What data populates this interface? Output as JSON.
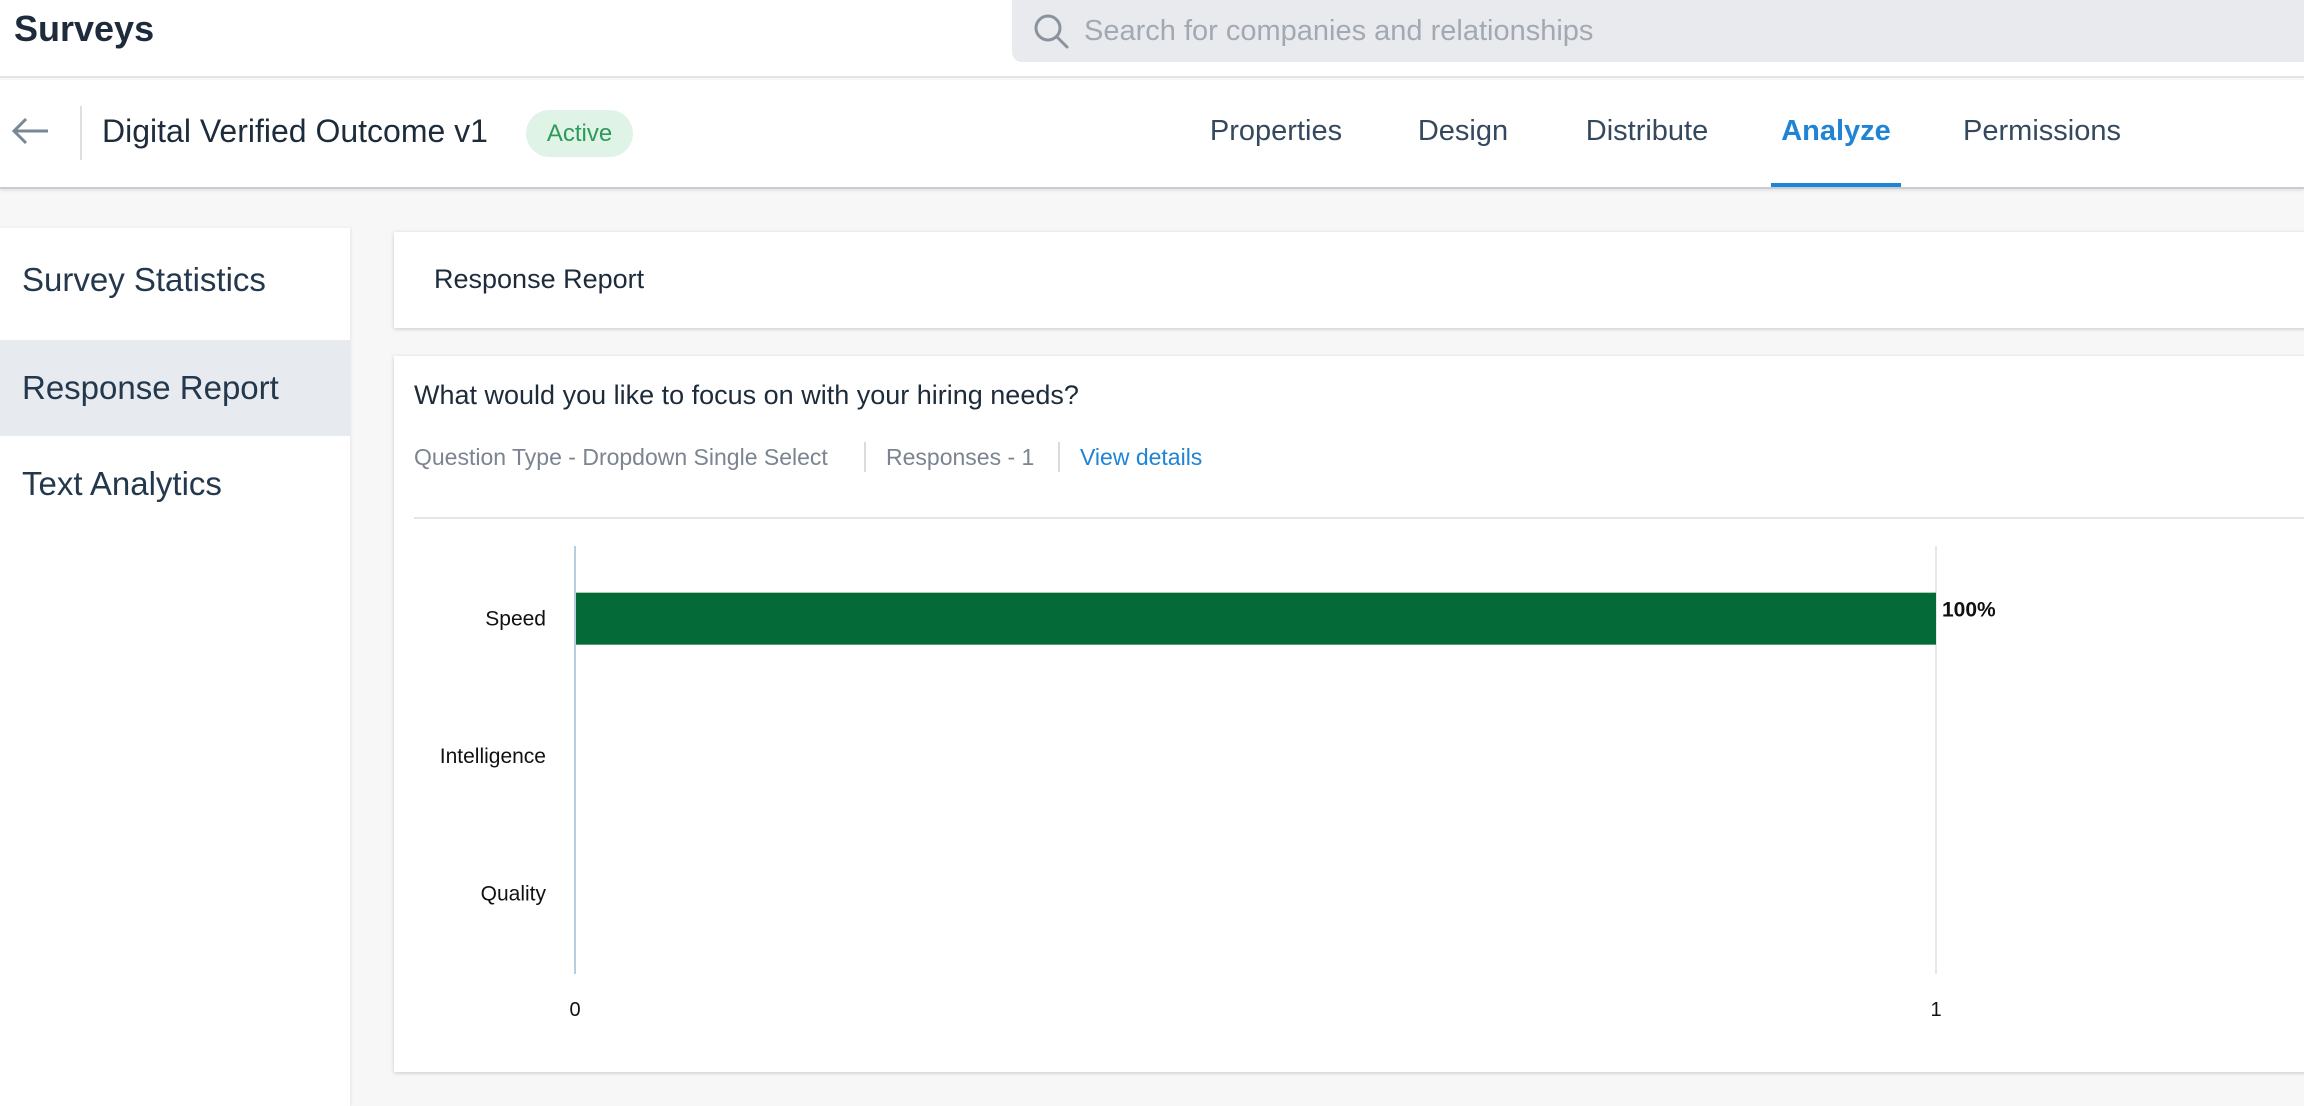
{
  "app": {
    "title": "Surveys"
  },
  "search": {
    "placeholder": "Search for companies and relationships",
    "icon": "search-icon"
  },
  "header": {
    "back_icon": "arrow-left-icon",
    "survey_title": "Digital Verified Outcome v1",
    "status": "Active",
    "status_color": "#2e9a5a",
    "tabs": [
      {
        "label": "Properties",
        "active": false
      },
      {
        "label": "Design",
        "active": false
      },
      {
        "label": "Distribute",
        "active": false
      },
      {
        "label": "Analyze",
        "active": true
      },
      {
        "label": "Permissions",
        "active": false
      }
    ]
  },
  "sidebar": {
    "items": [
      {
        "label": "Survey Statistics",
        "active": false
      },
      {
        "label": "Response Report",
        "active": true
      },
      {
        "label": "Text Analytics",
        "active": false
      }
    ]
  },
  "report": {
    "title": "Response Report",
    "question": {
      "text": "What would you like to focus on with your hiring needs?",
      "type": "Question Type - Dropdown Single Select",
      "responses": "Responses - 1",
      "view_details": "View details"
    }
  },
  "colors": {
    "accent": "#1f84d6",
    "bar": "#046a38"
  },
  "chart_data": {
    "type": "bar",
    "orientation": "horizontal",
    "categories": [
      "Speed",
      "Intelligence",
      "Quality"
    ],
    "values": [
      1,
      0,
      0
    ],
    "data_labels": [
      "100%",
      "",
      ""
    ],
    "xlim": [
      0,
      1
    ],
    "xticks": [
      "0",
      "1"
    ],
    "grid": true,
    "bar_color": "#046a38"
  }
}
